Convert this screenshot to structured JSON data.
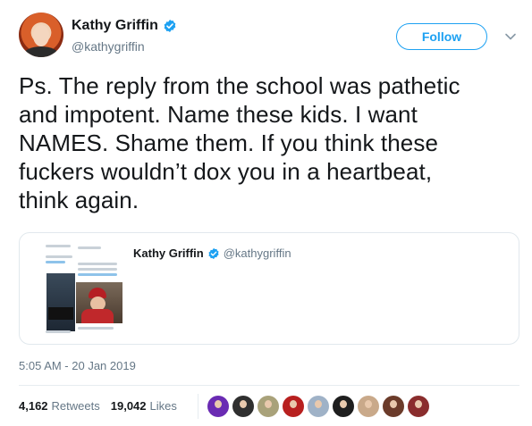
{
  "author": {
    "display_name": "Kathy Griffin",
    "handle": "@kathygriffin",
    "verified": true
  },
  "actions": {
    "follow_label": "Follow"
  },
  "tweet": {
    "text": "Ps. The reply from the school was pathetic\nand impotent. Name these kids. I want\nNAMES. Shame them. If you think these\nfuckers wouldn’t dox you in a heartbeat,\nthink again."
  },
  "quoted_tweet": {
    "display_name": "Kathy Griffin",
    "handle": "@kathygriffin",
    "verified": true
  },
  "timestamp": "5:05 AM - 20 Jan 2019",
  "stats": {
    "retweets_count": "4,162",
    "retweets_label": "Retweets",
    "likes_count": "19,042",
    "likes_label": "Likes"
  },
  "colors": {
    "accent": "#1da1f2",
    "text_primary": "#14171a",
    "text_secondary": "#657786",
    "border": "#e1e8ed"
  },
  "liker_avatars": [
    {
      "color": "#6a2bb3"
    },
    {
      "color": "#2f2f2f"
    },
    {
      "color": "#a9a27a"
    },
    {
      "color": "#b8201f"
    },
    {
      "color": "#9fb2c7"
    },
    {
      "color": "#1e1e1e"
    },
    {
      "color": "#c9a98a"
    },
    {
      "color": "#6b3b2a"
    },
    {
      "color": "#8a2d2d"
    }
  ]
}
